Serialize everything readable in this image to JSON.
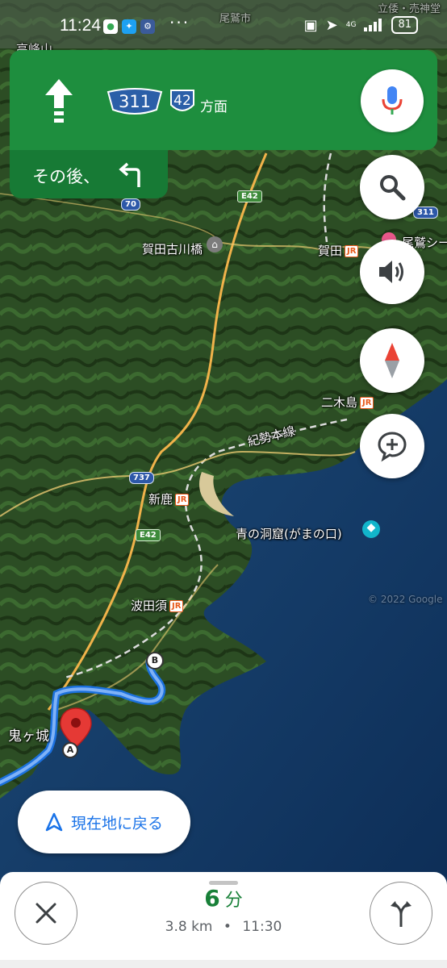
{
  "status_bar": {
    "time": "11:24",
    "battery": "81",
    "network": "4G",
    "dots": "···"
  },
  "navigation": {
    "route_311": "311",
    "route_42": "42",
    "direction_suffix": "方面",
    "then_label": "その後、",
    "colors": {
      "banner": "#1e8e3e",
      "banner_sub": "#177a35"
    }
  },
  "map": {
    "labels": {
      "kadakogawa_bridge": "賀田古川橋",
      "kada": "賀田",
      "owase_sea": "尾鷲シー",
      "nigishima": "二木島",
      "kisei_line": "紀勢本線",
      "shinshika": "新鹿",
      "aono_doukutsu": "青の洞窟(がまの口)",
      "hatasu": "波田須",
      "onigajo": "鬼ヶ城",
      "takamine": "高峰山",
      "owase_city": "尾鷲市",
      "rikko": "立倭・売神堂",
      "jr_mark": "JR"
    },
    "road_tags": {
      "e42_top": "E42",
      "e42_bottom": "E42",
      "r70": "70",
      "r737": "737",
      "r311": "311"
    },
    "markers": {
      "a": "A",
      "b": "B"
    },
    "watermark": "© 2022 Google"
  },
  "controls": {
    "recenter_label": "現在地に戻る"
  },
  "trip": {
    "duration_value": "6",
    "duration_unit": "分",
    "distance": "3.8 km",
    "separator": "•",
    "arrival": "11:30"
  }
}
